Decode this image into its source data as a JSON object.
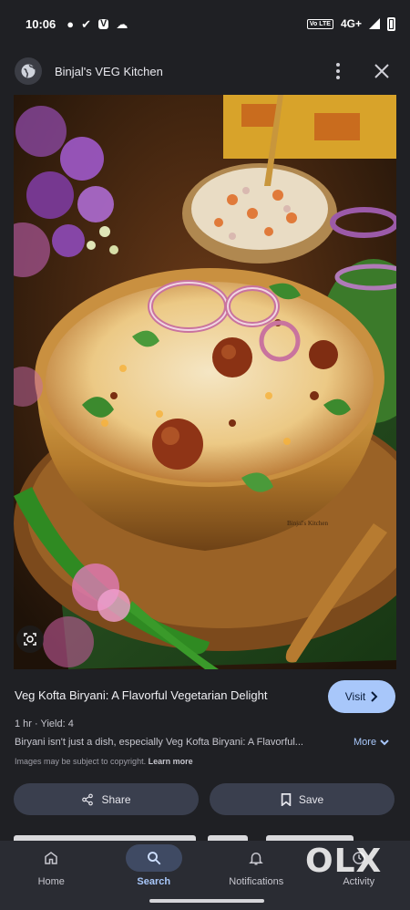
{
  "status_bar": {
    "time": "10:06",
    "network": "4G+",
    "volte": "Vo LTE"
  },
  "header": {
    "site_name": "Binjal's VEG Kitchen"
  },
  "result": {
    "title": "Veg Kofta Biryani: A Flavorful Vegetarian Delight",
    "meta": "1 hr · Yield: 4",
    "description": "Biryani isn't just a dish, especially Veg Kofta Biryani: A Flavorful...",
    "more_label": "More",
    "visit_label": "Visit",
    "copyright_text": "Images may be subject to copyright.",
    "learn_more": "Learn more",
    "bowl_brand": "Binjal's Kitchen"
  },
  "actions": {
    "share_label": "Share",
    "save_label": "Save"
  },
  "bottom_nav": {
    "items": [
      {
        "label": "Home",
        "icon": "home-icon"
      },
      {
        "label": "Search",
        "icon": "search-icon",
        "active": true
      },
      {
        "label": "Notifications",
        "icon": "bell-icon"
      },
      {
        "label": "Activity",
        "icon": "activity-icon"
      }
    ]
  },
  "watermark": "OLX",
  "colors": {
    "background": "#1f2024",
    "accent": "#a8c7fa",
    "button_bg": "#3a3f4e"
  }
}
